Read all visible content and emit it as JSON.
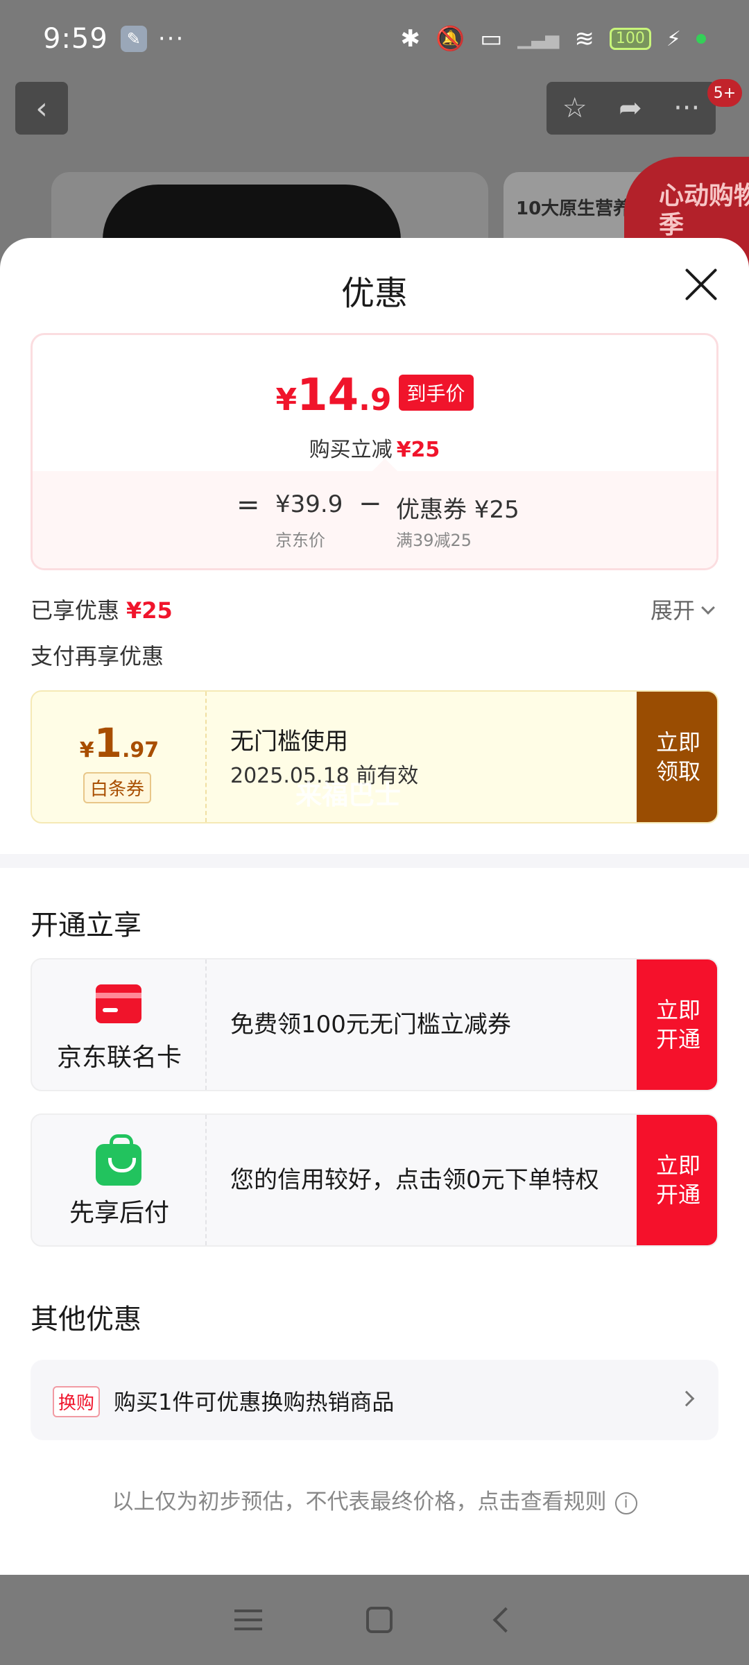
{
  "status_bar": {
    "time": "9:59",
    "battery": "100",
    "icons": [
      "wrench-icon",
      "bluetooth-icon",
      "mute-icon",
      "laptop-icon",
      "signal-icon",
      "wifi-icon",
      "battery-icon",
      "charging-icon"
    ]
  },
  "background": {
    "badge": "5+",
    "side_text": "10大原生营养",
    "promo": "心动购物季"
  },
  "sheet": {
    "title": "优惠"
  },
  "price_card": {
    "yen": "¥",
    "price_int": "14",
    "price_dec": ".9",
    "tag": "到手价",
    "sub_label": "购买立减",
    "sub_value": "¥25",
    "eq": "=",
    "jd_price": "¥39.9",
    "jd_price_label": "京东价",
    "minus": "−",
    "coupon_value": "优惠券 ¥25",
    "coupon_label": "满39减25"
  },
  "enjoyed": {
    "label": "已享优惠",
    "value": "¥25",
    "expand": "展开"
  },
  "pay_more": "支付再享优惠",
  "baitiao_coupon": {
    "yen": "¥",
    "amount_int": "1",
    "amount_dec": ".97",
    "type": "白条券",
    "title": "无门槛使用",
    "date": "2025.05.18 前有效",
    "watermark": "来福巴士",
    "button": "立即领取"
  },
  "open_section": {
    "title": "开通立享",
    "offers": [
      {
        "label": "京东联名卡",
        "text": "免费领100元无门槛立减券",
        "button": "立即开通"
      },
      {
        "label": "先享后付",
        "text": "您的信用较好，点击领0元下单特权",
        "button": "立即开通"
      }
    ]
  },
  "other_section": {
    "title": "其他优惠",
    "tag": "换购",
    "text": "购买1件可优惠换购热销商品"
  },
  "disclaimer": "以上仅为初步预估，不代表最终价格，点击查看规则"
}
